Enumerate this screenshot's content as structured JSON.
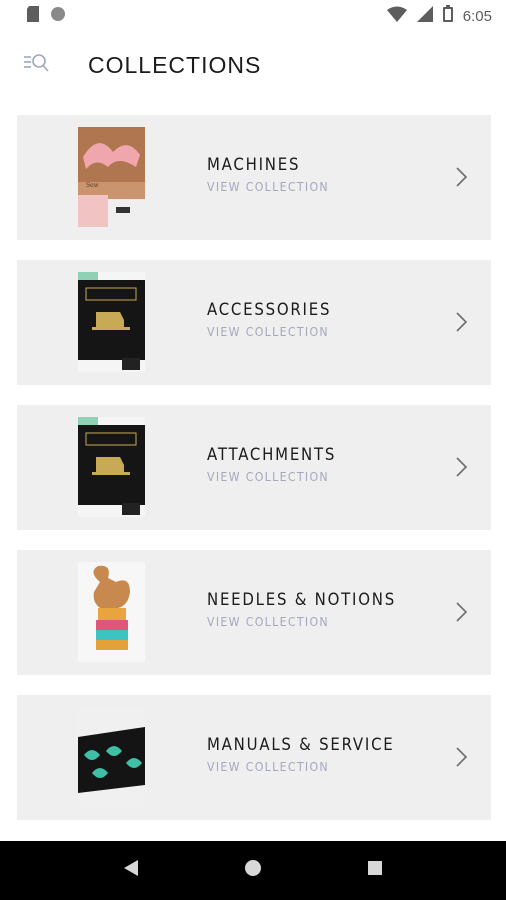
{
  "status_bar": {
    "time": "6:05",
    "icons": [
      "sd-card-icon",
      "circle-notification-icon",
      "wifi-icon",
      "signal-icon",
      "battery-icon"
    ]
  },
  "header": {
    "title": "COLLECTIONS",
    "menu_icon": "menu-search-icon"
  },
  "collections": [
    {
      "name": "MACHINES",
      "link": "VIEW COLLECTION",
      "thumb": "machines-thumbnail"
    },
    {
      "name": "ACCESSORIES",
      "link": "VIEW COLLECTION",
      "thumb": "accessories-thumbnail"
    },
    {
      "name": "ATTACHMENTS",
      "link": "VIEW COLLECTION",
      "thumb": "attachments-thumbnail"
    },
    {
      "name": "NEEDLES & NOTIONS",
      "link": "VIEW COLLECTION",
      "thumb": "needles-notions-thumbnail"
    },
    {
      "name": "MANUALS & SERVICE",
      "link": "VIEW COLLECTION",
      "thumb": "manuals-service-thumbnail"
    }
  ],
  "nav_bar": {
    "buttons": [
      "back-icon",
      "home-icon",
      "recents-icon"
    ]
  },
  "colors": {
    "card_background": "#efefef",
    "title_text": "#1b1b1b",
    "link_text": "#a3a8bd",
    "nav_bar": "#000000"
  }
}
